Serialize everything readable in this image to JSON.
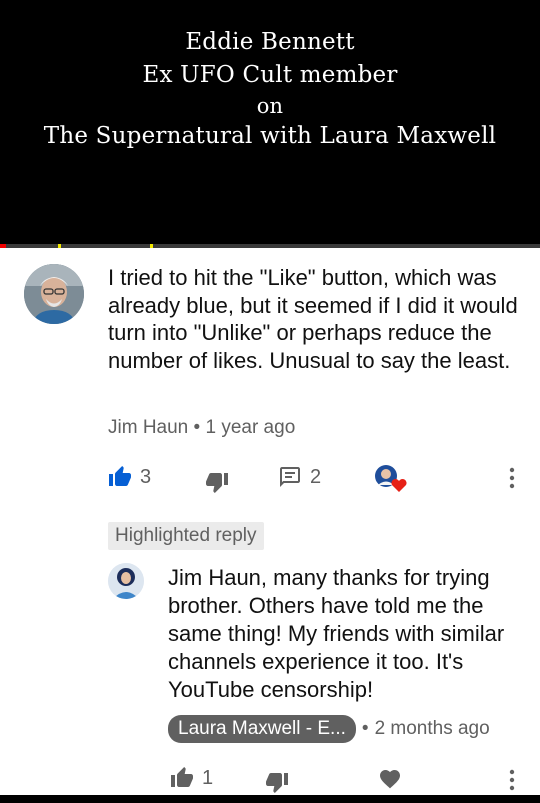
{
  "video": {
    "title_lines": [
      "Eddie Bennett",
      "Ex UFO Cult member",
      "on",
      "The Supernatural with Laura Maxwell"
    ]
  },
  "comment": {
    "text": "I tried to hit the \"Like\" button, which was already blue, but it seemed if I did it would turn into \"Unlike\" or perhaps reduce the number of likes. Unusual to say the least.",
    "author": "Jim Haun",
    "separator": "•",
    "time": "1 year ago",
    "like_count": "3",
    "reply_count": "2",
    "like_active_color": "#065fd4",
    "heart_color": "#e62117"
  },
  "reply": {
    "highlight_label": "Highlighted reply",
    "text": "Jim Haun, many thanks for trying brother. Others have told me the same thing! My friends with similar channels experience it too. It's YouTube censorship!",
    "author": "Laura Maxwell - E...",
    "separator": "•",
    "time": "2 months ago",
    "like_count": "1"
  }
}
